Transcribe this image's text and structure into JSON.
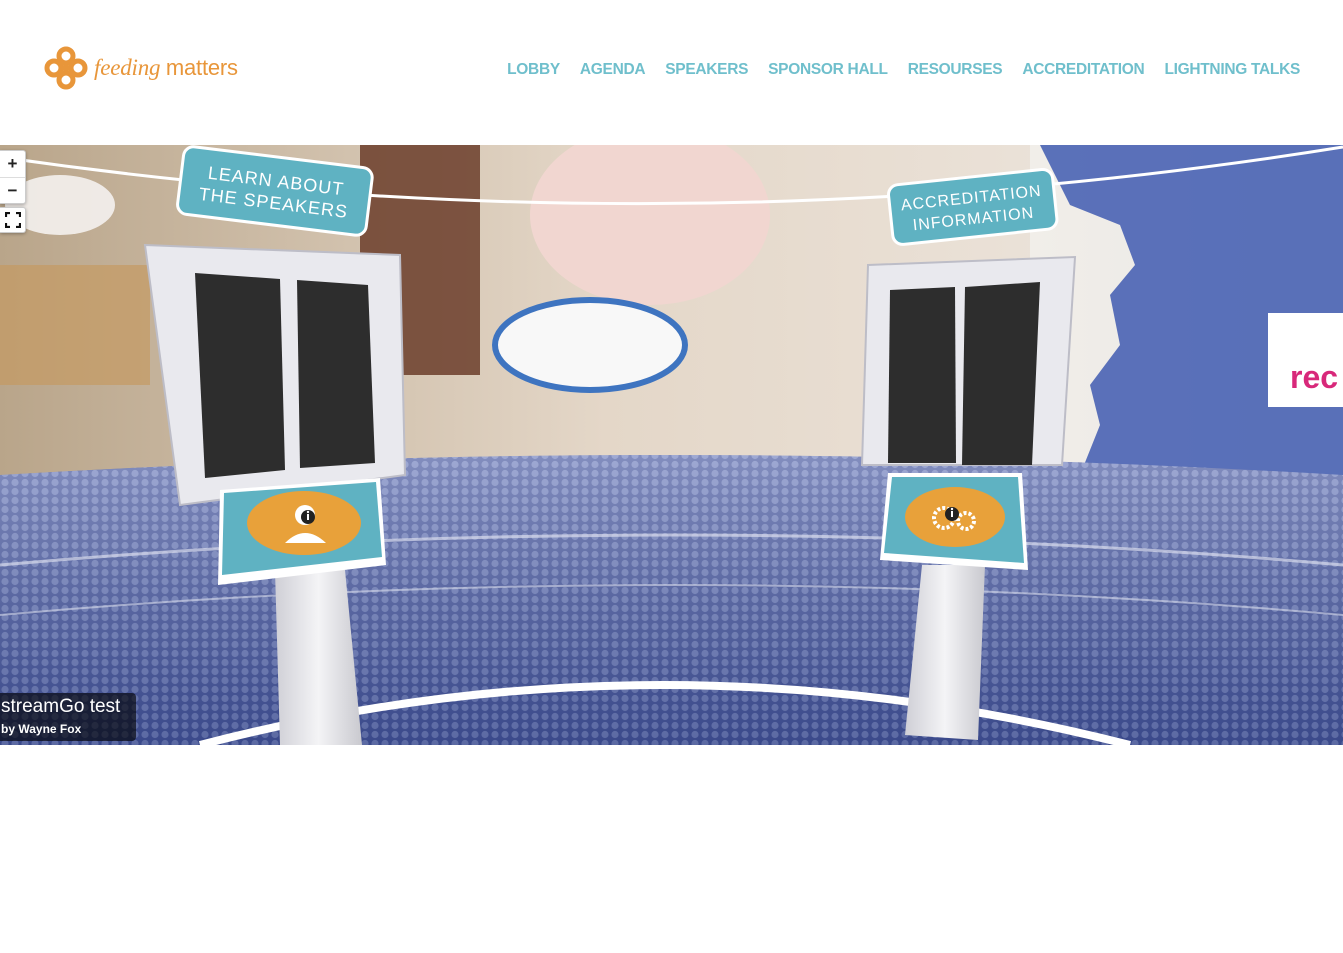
{
  "brand": {
    "name_word1": "feeding",
    "name_word2": "matters",
    "accent_color": "#e8963a"
  },
  "nav": {
    "color": "#6fbfcc",
    "items": [
      "LOBBY",
      "AGENDA",
      "SPEAKERS",
      "SPONSOR HALL",
      "RESOURSES",
      "ACCREDITATION",
      "LIGHTNING TALKS"
    ]
  },
  "viewer": {
    "zoom_in_label": "+",
    "zoom_out_label": "−",
    "fullscreen_icon": "fullscreen-icon",
    "info": {
      "title": "streamGo test",
      "author": "by Wayne Fox"
    },
    "signs": {
      "left_line1": "LEARN ABOUT",
      "left_line2": "THE SPEAKERS",
      "right_line1": "ACCREDITATION",
      "right_line2": "INFORMATION"
    },
    "kiosks": {
      "left_icon": "speaker-info-icon",
      "right_icon": "gears-info-icon"
    },
    "partial_banner_text": "rec",
    "colors": {
      "sign": "#5fb2c2",
      "kiosk_top": "#5fb2c2",
      "kiosk_disc": "#e8a13a",
      "banner_text": "#d8287a"
    }
  }
}
